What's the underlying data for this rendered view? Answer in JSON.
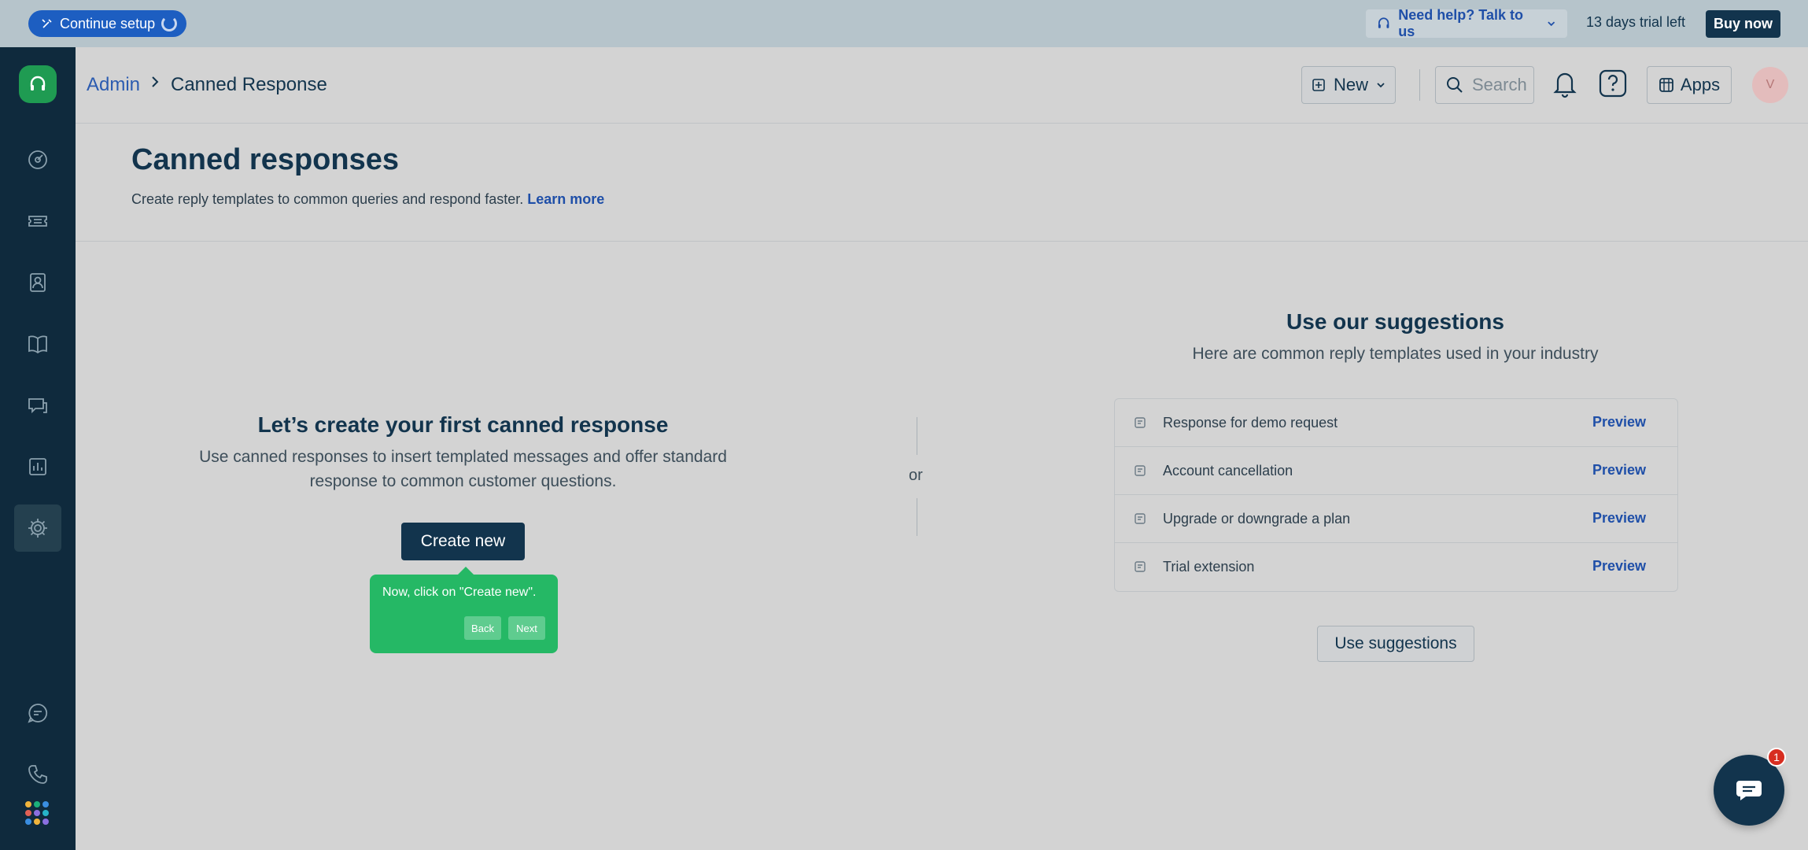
{
  "topbar": {
    "setup_label": "Continue setup",
    "help_label": "Need help? Talk to us",
    "trial_text": "13 days trial left",
    "buy_label": "Buy now"
  },
  "header": {
    "breadcrumb_root": "Admin",
    "breadcrumb_current": "Canned Response",
    "new_label": "New",
    "search_placeholder": "Search",
    "apps_label": "Apps",
    "avatar_initial": "V"
  },
  "page": {
    "title": "Canned responses",
    "description": "Create reply templates to common queries and respond faster.",
    "learn_more": "Learn more"
  },
  "empty_state": {
    "title": "Let’s create your first canned response",
    "description": "Use canned responses to insert templated messages and offer standard response to common customer questions.",
    "create_label": "Create new",
    "or_text": "or"
  },
  "tooltip": {
    "text": "Now, click on \"Create new\".",
    "back_label": "Back",
    "next_label": "Next"
  },
  "suggestions": {
    "title": "Use our suggestions",
    "description": "Here are common reply templates used in your industry",
    "items": [
      {
        "label": "Response for demo request",
        "action": "Preview"
      },
      {
        "label": "Account cancellation",
        "action": "Preview"
      },
      {
        "label": "Upgrade or downgrade a plan",
        "action": "Preview"
      },
      {
        "label": "Trial extension",
        "action": "Preview"
      }
    ],
    "use_label": "Use suggestions"
  },
  "chat": {
    "badge_count": "1"
  },
  "sidebar": {
    "icons": [
      "headset-logo-icon",
      "dashboard-icon",
      "tickets-icon",
      "contacts-icon",
      "solutions-icon",
      "forums-icon",
      "analytics-icon",
      "admin-gear-icon",
      "chat-icon",
      "phone-icon",
      "app-switcher-icon"
    ]
  },
  "colors": {
    "accent": "#1d5ec1",
    "primary_dark": "#12344d",
    "success": "#25b865",
    "link": "#1f4fa8"
  }
}
